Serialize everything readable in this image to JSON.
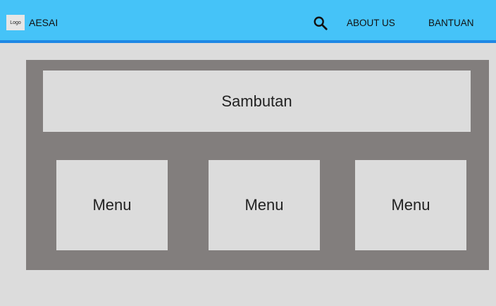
{
  "header": {
    "logo_text": "Logo",
    "app_name": "AESAI",
    "search_icon": "search-icon",
    "nav": {
      "about_label": "ABOUT US",
      "help_label": "BANTUAN"
    }
  },
  "main": {
    "welcome_label": "Sambutan",
    "menus": [
      {
        "label": "Menu"
      },
      {
        "label": "Menu"
      },
      {
        "label": "Menu"
      }
    ]
  },
  "colors": {
    "header_bg": "#45c3f8",
    "header_border": "#1e88e5",
    "panel_bg": "#827e7d",
    "tile_bg": "#dcdcdc"
  }
}
